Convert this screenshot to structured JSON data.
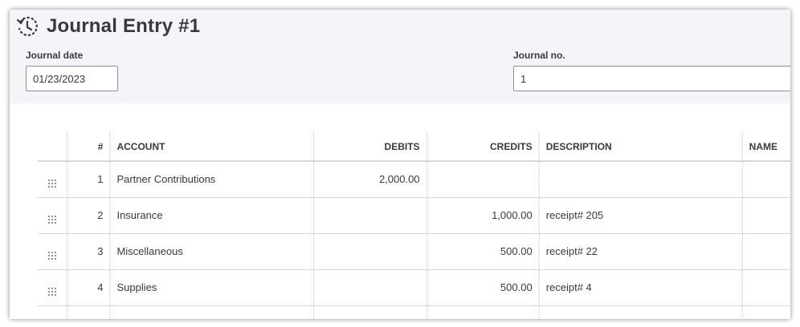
{
  "header": {
    "title": "Journal Entry #1",
    "icon": "history-icon"
  },
  "fields": {
    "journal_date": {
      "label": "Journal date",
      "value": "01/23/2023"
    },
    "journal_no": {
      "label": "Journal no.",
      "value": "1"
    }
  },
  "table": {
    "columns": {
      "num": "#",
      "account": "ACCOUNT",
      "debits": "DEBITS",
      "credits": "CREDITS",
      "description": "DESCRIPTION",
      "name": "NAME"
    },
    "rows": [
      {
        "num": "1",
        "account": "Partner Contributions",
        "debits": "2,000.00",
        "credits": "",
        "description": "",
        "name": ""
      },
      {
        "num": "2",
        "account": "Insurance",
        "debits": "",
        "credits": "1,000.00",
        "description": "receipt# 205",
        "name": ""
      },
      {
        "num": "3",
        "account": "Miscellaneous",
        "debits": "",
        "credits": "500.00",
        "description": "receipt# 22",
        "name": ""
      },
      {
        "num": "4",
        "account": "Supplies",
        "debits": "",
        "credits": "500.00",
        "description": "receipt# 4",
        "name": ""
      }
    ]
  },
  "colors": {
    "panel_bg": "#f4f5f8",
    "text": "#393a3d",
    "border": "#8d9096"
  }
}
